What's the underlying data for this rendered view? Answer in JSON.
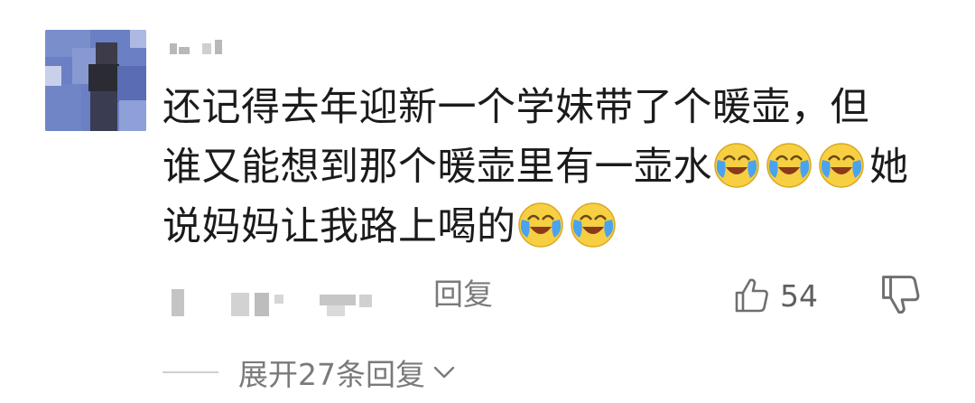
{
  "comment": {
    "line1": "还记得去年迎新一个学妹带了个暖壶，但",
    "line2": "谁又能想到那个暖壶里有一壶水",
    "line2_tail": "她",
    "line3": "说妈妈让我路上喝的",
    "emojis": [
      "crying-laughing-emoji",
      "crying-laughing-emoji",
      "crying-laughing-emoji",
      "crying-laughing-emoji",
      "crying-laughing-emoji"
    ]
  },
  "actions": {
    "reply_label": "回复",
    "like_count": "54",
    "icons": {
      "like": "thumbs-up-icon",
      "dislike": "thumbs-down-icon",
      "expand": "chevron-down-icon"
    }
  },
  "replies": {
    "expand_label": "展开27条回复"
  },
  "colors": {
    "text": "#1b1b1b",
    "secondary": "#7a7a7a",
    "emoji_face": "#f7cf43",
    "emoji_tear": "#4aa3ef"
  }
}
